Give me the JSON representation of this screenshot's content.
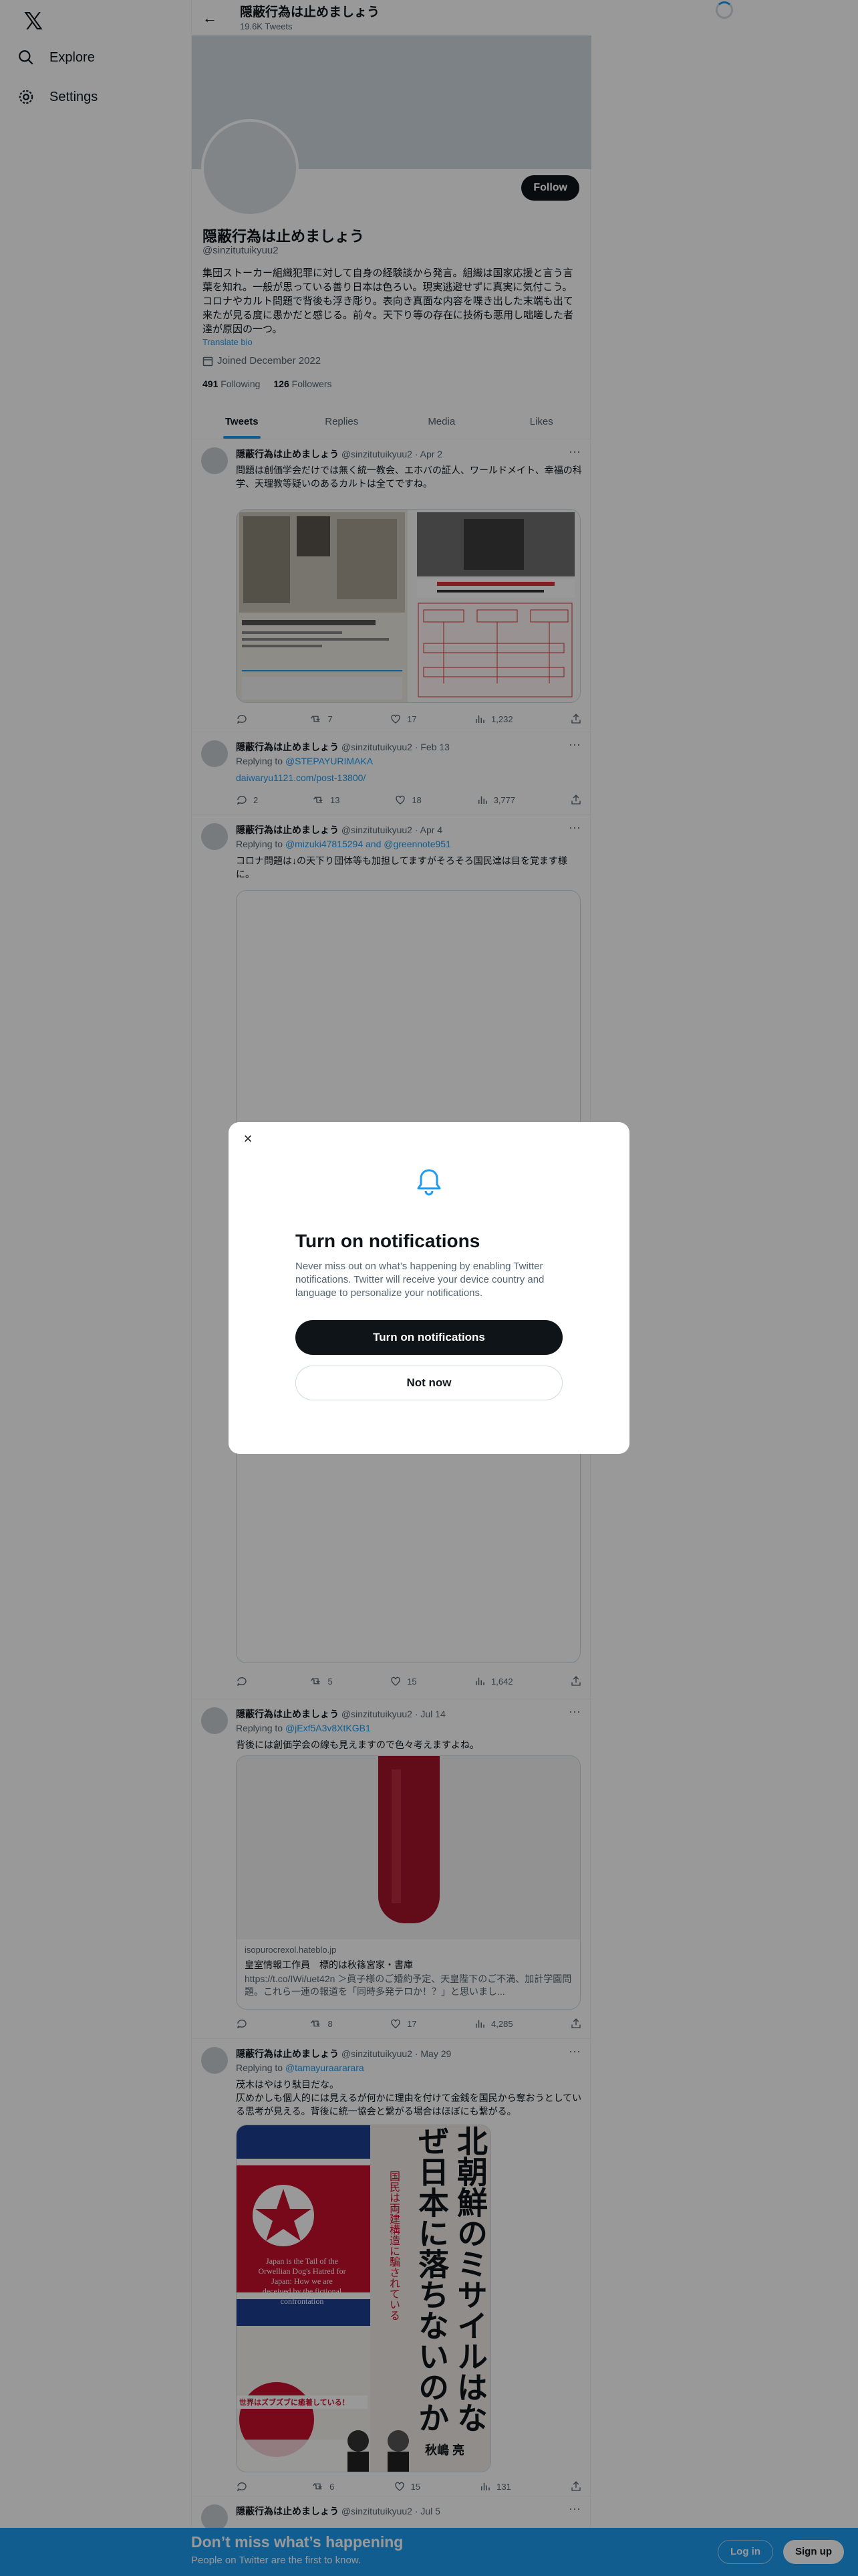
{
  "nav": {
    "logo": "𝕏",
    "explore": "Explore",
    "settings": "Settings"
  },
  "topbar": {
    "name": "隠蔽行為は止めましょう",
    "tweet_count": "19.6K Tweets"
  },
  "profile": {
    "name": "隠蔽行為は止めましょう",
    "handle": "@sinzitutuikyuu2",
    "follow_label": "Follow",
    "bio": "集団ストーカー組織犯罪に対して自身の経験談から発言。組織は国家応援と言う言葉を知れ。一般が思っている善り日本は色ろい。現実逃避せずに真実に気付こう。コロナやカルト問題で背後も浮き彫り。表向き真面な内容を喋き出した末端も出て来たが見る度に愚かだと感じる。前々。天下り等の存在に技術も悪用し咄嗟した者達が原因の一つ。",
    "translate": "Translate bio",
    "joined": "Joined December 2022",
    "following_count": "491",
    "following_label": "Following",
    "followers_count": "126",
    "followers_label": "Followers"
  },
  "tabs": [
    "Tweets",
    "Replies",
    "Media",
    "Likes"
  ],
  "tweets": [
    {
      "name": "隠蔽行為は止めましょう",
      "handle": "@sinzitutuikyuu2",
      "date": "· Apr 2",
      "text": "問題は創価学会だけでは無く統一教会、エホバの証人、ワールドメイト、幸福の科学、天理教等疑いのあるカルトは全てですね。",
      "replies": "",
      "retweets": "7",
      "likes": "17",
      "views": "1,232"
    },
    {
      "name": "隠蔽行為は止めましょう",
      "handle": "@sinzitutuikyuu2",
      "date": "· Feb 13",
      "reply_prefix": "Replying to",
      "reply_to": "@STEPAYURIMAKA",
      "text": "daiwaryu1121.com/post-13800/",
      "replies": "2",
      "retweets": "13",
      "likes": "18",
      "views": "3,777"
    },
    {
      "name": "隠蔽行為は止めましょう",
      "handle": "@sinzitutuikyuu2",
      "date": "· Apr 4",
      "reply_prefix": "Replying to",
      "reply_to": "@mizuki47815294 and @greennote951",
      "text": "コロナ問題は↓の天下り団体等も加担してますがそろそろ国民達は目を覚ます様に。",
      "replies": "",
      "retweets": "5",
      "likes": "15",
      "views": "1,642"
    },
    {
      "name": "隠蔽行為は止めましょう",
      "handle": "@sinzitutuikyuu2",
      "date": "· Jul 14",
      "reply_prefix": "Replying to",
      "reply_to": "@jExf5A3v8XtKGB1",
      "text": "背後には創価学会の線も見えますので色々考えますよね。",
      "card_site": "isopurocrexol.hateblo.jp",
      "card_title": "皇室情報工作員　標的は秋篠宮家・書庫",
      "card_desc": "https://t.co/IWi/uet42n ＞眞子様のご婚約予定、天皇陛下のご不満、加計学園問題。これら一連の報道を「同時多発テロか！？」と思いまし...",
      "replies": "",
      "retweets": "8",
      "likes": "17",
      "views": "4,285"
    },
    {
      "name": "隠蔽行為は止めましょう",
      "handle": "@sinzitutuikyuu2",
      "date": "· May 29",
      "reply_prefix": "Replying to",
      "reply_to": "@tamayuraararara",
      "text": "茂木はやはり駄目だな。\n仄めかしも個人的には見えるが何かに理由を付けて金銭を国民から奪おうとしている思考が見える。背後に統一協会と繋がる場合はほぼにも繋がる。",
      "book_title": "北朝鮮のミサイルはなぜ日本に落ちないのか",
      "book_sub": "国民は両建構造に騙されている",
      "book_en": "Japan is the Tail of the Orwellian Dog's Hatred for Japan: How we are deceived by the fictional confrontation",
      "book_author": "秋嶋 亮",
      "book_banner": "世界はズブズブに癒着している！",
      "replies": "",
      "retweets": "6",
      "likes": "15",
      "views": "131"
    },
    {
      "name": "隠蔽行為は止めましょう",
      "handle": "@sinzitutuikyuu2",
      "date": "· Jul 5",
      "text": ""
    }
  ],
  "bottombar": {
    "title": "Don’t miss what’s happening",
    "subtitle": "People on Twitter are the first to know.",
    "login": "Log in",
    "signup": "Sign up"
  },
  "modal": {
    "close": "×",
    "title": "Turn on notifications",
    "description": "Never miss out on what’s happening by enabling Twitter notifications. Twitter will receive your device country and language to personalize your notifications.",
    "primary": "Turn on notifications",
    "secondary": "Not now"
  },
  "colors": {
    "accent": "#1d9bf0",
    "text": "#0f1419",
    "muted": "#536471",
    "overlay": "rgba(0,0,0,0.4)"
  }
}
